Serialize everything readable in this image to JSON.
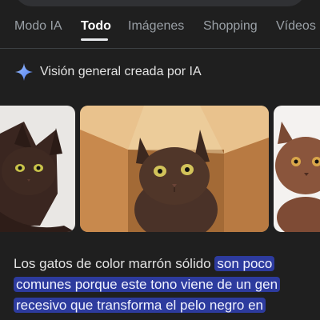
{
  "tabs": [
    {
      "label": "Modo IA"
    },
    {
      "label": "Todo",
      "active": true
    },
    {
      "label": "Imágenes"
    },
    {
      "label": "Shopping"
    },
    {
      "label": "Vídeos"
    }
  ],
  "ai_overview": {
    "title": "Visión general creada por IA",
    "icon": "sparkle-icon",
    "images": [
      {
        "name": "brown-cat-image-left",
        "subject": "cat"
      },
      {
        "name": "brown-cat-in-box-image",
        "subject": "cat"
      },
      {
        "name": "brown-cat-image-right",
        "subject": "cat"
      }
    ],
    "text_plain": "Los gatos de color marrón sólido",
    "text_highlighted": "son poco comunes porque este tono viene de un gen recesivo que transforma el pelo negro en"
  },
  "colors": {
    "background": "#1f1f1f",
    "highlight": "#2d3b9e",
    "sparkle_blue": "#8ab4f8",
    "active_tab": "#ffffff"
  }
}
